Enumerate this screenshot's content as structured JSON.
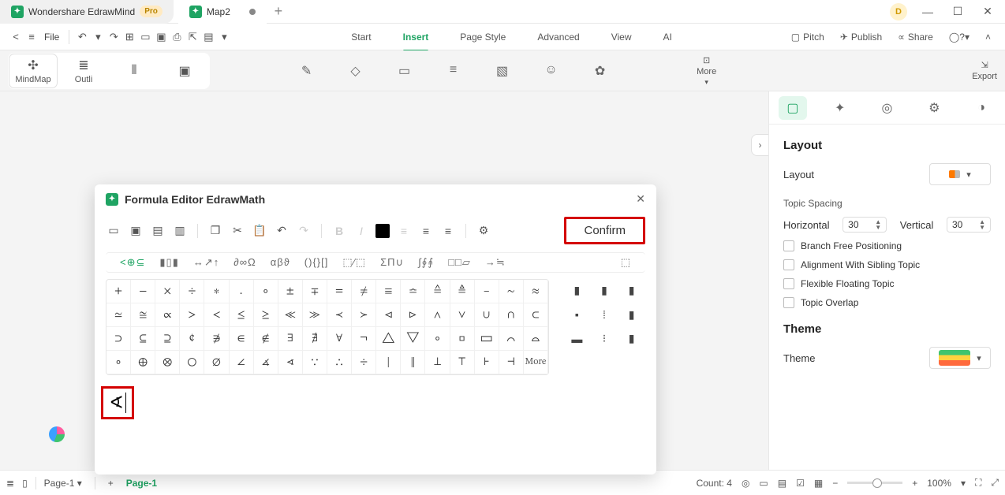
{
  "app": {
    "name": "Wondershare EdrawMind",
    "pro_label": "Pro",
    "doc_tab": "Map2",
    "avatar_initial": "D"
  },
  "menu": {
    "file_label": "File",
    "tabs": [
      "Start",
      "Insert",
      "Page Style",
      "Advanced",
      "View",
      "AI"
    ],
    "active_tab": "Insert",
    "right": {
      "pitch": "Pitch",
      "publish": "Publish",
      "share": "Share"
    }
  },
  "ribbon": {
    "view_modes": [
      "MindMap",
      "Outli",
      "",
      ""
    ],
    "more_label": "More",
    "export_label": "Export"
  },
  "modal": {
    "title": "Formula Editor EdrawMath",
    "confirm_label": "Confirm",
    "categories": [
      "<⊕⊆",
      "▮▯▮",
      "↔↗↑",
      "∂∞Ω",
      "αβϑ",
      "(){}[]",
      "⬚⁄⬚",
      "ΣΠ∪",
      "∫∮⨙",
      "□□▱",
      "→≒",
      "⬚"
    ],
    "symbols_main": [
      "+",
      "−",
      "×",
      "÷",
      "∗",
      ".",
      "∘",
      "±",
      "∓",
      "=",
      "≠",
      "≡",
      "≏",
      "≙",
      "≜",
      "–",
      "∼",
      "≈",
      "≃",
      "≅",
      "∝",
      ">",
      "<",
      "≤",
      "≥",
      "≪",
      "≫",
      "≺",
      "≻",
      "⊲",
      "⊳",
      "∧",
      "∨",
      "∪",
      "∩",
      "⊂",
      "⊃",
      "⊆",
      "⊇",
      "¢",
      "∌",
      "∈",
      "∉",
      "∃",
      "∄",
      "∀",
      "¬",
      "△",
      "▽",
      "∘",
      "▫",
      "▭",
      "⌒",
      "⌓",
      "∘",
      "⊕",
      "⊗",
      "○",
      "∅",
      "∠",
      "∡",
      "∢",
      "∵",
      "∴",
      "÷",
      "|",
      "‖",
      "⊥",
      "⊤",
      "⊦",
      "⊣",
      "More"
    ],
    "symbols_side": [
      "▮",
      "▮",
      "▮",
      "▪",
      "⁞",
      "▮",
      "▬",
      "⁝",
      "▮",
      "",
      "",
      ""
    ],
    "preview_symbol": "∢"
  },
  "side": {
    "title_layout": "Layout",
    "layout_label": "Layout",
    "topic_spacing_label": "Topic Spacing",
    "h_label": "Horizontal",
    "h_value": "30",
    "v_label": "Vertical",
    "v_value": "30",
    "opts": [
      "Branch Free Positioning",
      "Alignment With Sibling Topic",
      "Flexible Floating Topic",
      "Topic Overlap"
    ],
    "title_theme": "Theme",
    "theme_label": "Theme"
  },
  "status": {
    "page_select": "Page-1",
    "page_tab": "Page-1",
    "count_label": "Count: 4",
    "zoom_label": "100%"
  }
}
